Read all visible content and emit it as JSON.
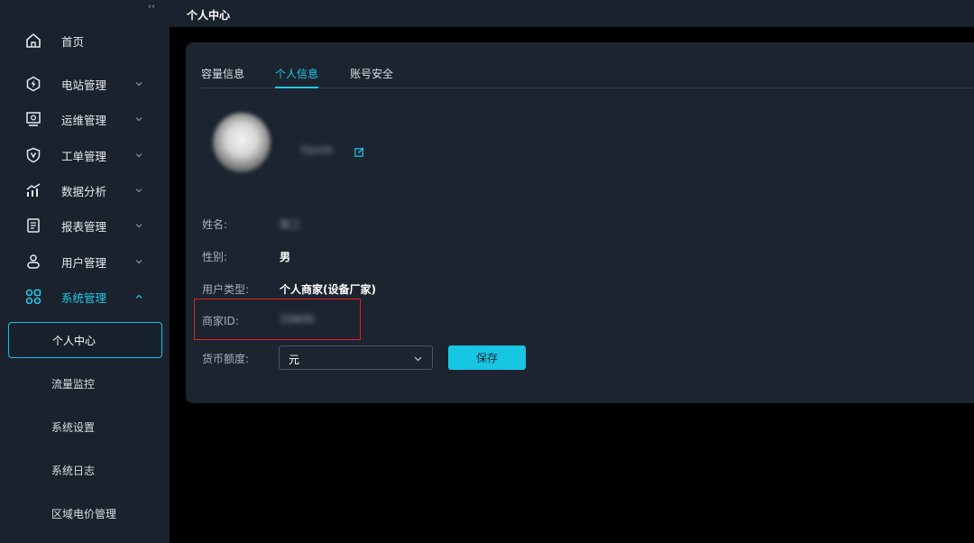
{
  "topbar": {
    "title": "个人中心"
  },
  "sidebar": {
    "collapse_glyph": "‹‹",
    "items": [
      {
        "label": "首页",
        "icon": "home-icon",
        "has_chevron": false
      },
      {
        "label": "电站管理",
        "icon": "power-station-icon",
        "has_chevron": true
      },
      {
        "label": "运维管理",
        "icon": "monitor-icon",
        "has_chevron": true
      },
      {
        "label": "工单管理",
        "icon": "shield-icon",
        "has_chevron": true
      },
      {
        "label": "数据分析",
        "icon": "chart-icon",
        "has_chevron": true
      },
      {
        "label": "报表管理",
        "icon": "report-icon",
        "has_chevron": true
      },
      {
        "label": "用户管理",
        "icon": "user-icon",
        "has_chevron": true
      },
      {
        "label": "系统管理",
        "icon": "apps-icon",
        "has_chevron": true,
        "expanded": true
      }
    ],
    "sub_items": [
      {
        "label": "个人中心",
        "current": true
      },
      {
        "label": "流量监控"
      },
      {
        "label": "系统设置"
      },
      {
        "label": "系统日志"
      },
      {
        "label": "区域电价管理"
      }
    ]
  },
  "tabs": [
    {
      "label": "容量信息"
    },
    {
      "label": "个人信息",
      "active": true
    },
    {
      "label": "账号安全"
    }
  ],
  "profile": {
    "nickname": "hpsds",
    "fields": {
      "name": {
        "label": "姓名:",
        "value": "张三"
      },
      "gender": {
        "label": "性别:",
        "value": "男"
      },
      "user_type": {
        "label": "用户类型:",
        "value": "个人商家(设备厂家)"
      },
      "merchant_id": {
        "label": "商家ID:",
        "value": "10800"
      },
      "currency": {
        "label": "货币额度:",
        "value": "元"
      }
    },
    "save_label": "保存"
  },
  "colors": {
    "accent": "#1fc8e8",
    "sidebar_bg": "#1a222d",
    "card_bg": "#1c2430",
    "highlight_red": "#e0202a"
  }
}
